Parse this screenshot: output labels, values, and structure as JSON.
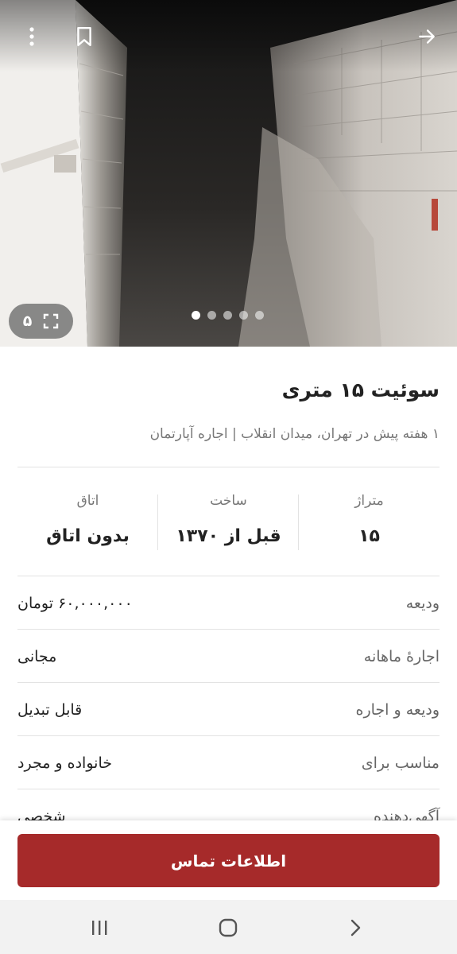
{
  "gallery": {
    "image_count": "۵",
    "dot_count": 5,
    "active_dot": 0
  },
  "listing": {
    "title": "سوئیت ۱۵ متری",
    "subtitle": "۱ هفته پیش در تهران، میدان انقلاب | اجاره آپارتمان"
  },
  "stats": [
    {
      "label": "متراژ",
      "value": "۱۵"
    },
    {
      "label": "ساخت",
      "value": "قبل از ۱۳۷۰"
    },
    {
      "label": "اتاق",
      "value": "بدون اتاق"
    }
  ],
  "details": [
    {
      "key": "ودیعه",
      "value": "۶۰,۰۰۰,۰۰۰ تومان"
    },
    {
      "key": "اجارهٔ ماهانه",
      "value": "مجانی"
    },
    {
      "key": "ودیعه و اجاره",
      "value": "قابل تبدیل"
    },
    {
      "key": "مناسب برای",
      "value": "خانواده و مجرد"
    },
    {
      "key": "آگهی‌دهنده",
      "value": "شخصی"
    }
  ],
  "action": {
    "contact_label": "اطلاعات تماس"
  },
  "colors": {
    "primary": "#a62a2a",
    "muted_text": "#777777",
    "divider": "#e3e3e3"
  },
  "icons": {
    "back": "arrow-right-icon",
    "bookmark": "bookmark-icon",
    "more": "more-vertical-icon",
    "gallery": "expand-icon"
  }
}
